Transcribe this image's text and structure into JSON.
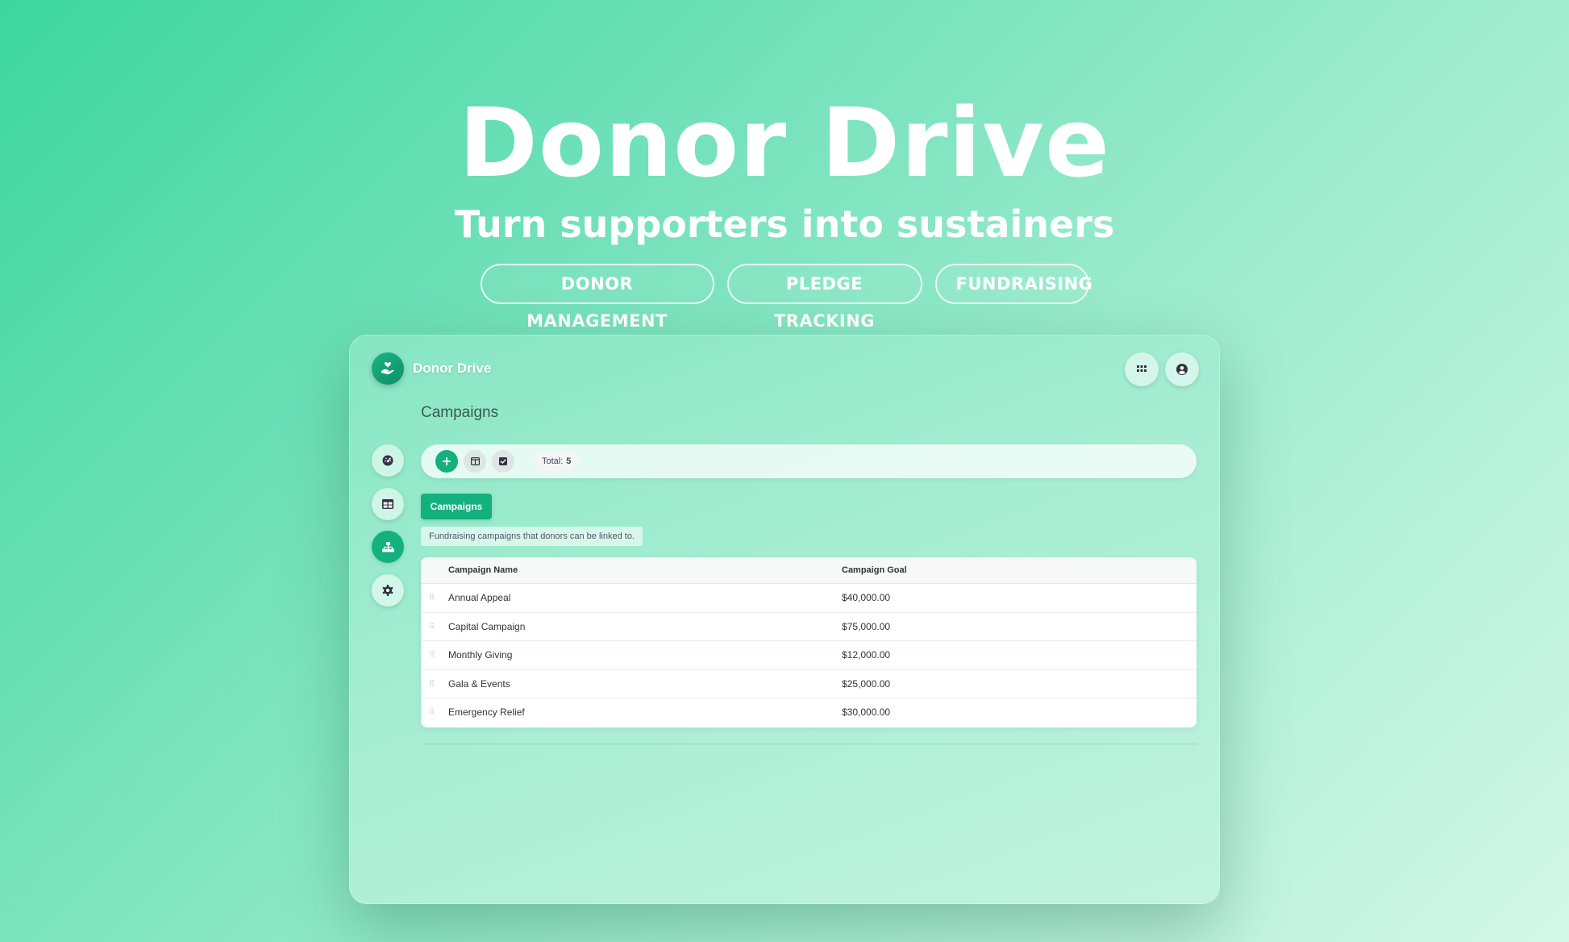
{
  "hero": {
    "title": "Donor Drive",
    "subtitle": "Turn supporters into sustainers",
    "tags": [
      "DONOR MANAGEMENT",
      "PLEDGE TRACKING",
      "FUNDRAISING"
    ]
  },
  "app": {
    "brand": "Donor Drive",
    "page_title": "Campaigns",
    "toolbar": {
      "total_label": "Total:",
      "total_value": "5"
    },
    "tab_label": "Campaigns",
    "description": "Fundraising campaigns that donors can be linked to.",
    "table": {
      "columns": [
        "Campaign Name",
        "Campaign Goal"
      ],
      "rows": [
        [
          "Annual Appeal",
          "$40,000.00"
        ],
        [
          "Capital Campaign",
          "$75,000.00"
        ],
        [
          "Monthly Giving",
          "$12,000.00"
        ],
        [
          "Gala & Events",
          "$25,000.00"
        ],
        [
          "Emergency Relief",
          "$30,000.00"
        ]
      ]
    },
    "icons": {
      "brand": "hand-heart-icon",
      "apps": "grid-icon",
      "user": "user-circle-icon",
      "sidebar": [
        "dashboard-icon",
        "table-icon",
        "sitemap-icon",
        "gear-icon"
      ],
      "toolbar": [
        "plus-icon",
        "columns-icon",
        "checkbox-icon"
      ]
    },
    "colors": {
      "accent": "#14b07e"
    }
  }
}
